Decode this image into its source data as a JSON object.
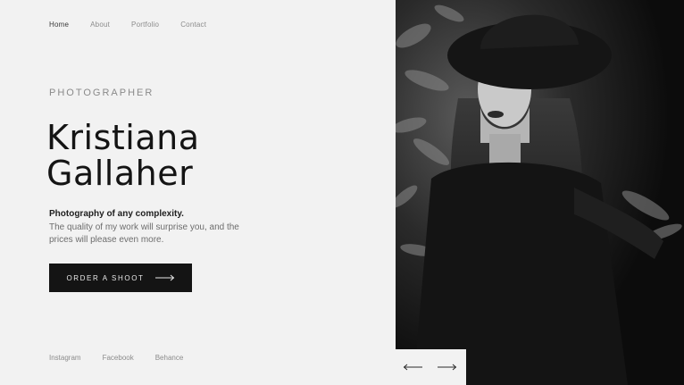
{
  "nav": {
    "items": [
      {
        "label": "Home",
        "active": true
      },
      {
        "label": "About",
        "active": false
      },
      {
        "label": "Portfolio",
        "active": false
      },
      {
        "label": "Contact",
        "active": false
      }
    ]
  },
  "hero": {
    "eyebrow": "PHOTOGRAPHER",
    "name_line1": "Kristiana",
    "name_line2": "Gallaher",
    "tagline": "Photography of any complexity.",
    "description": "The quality of my work will surprise you, and the prices will please even more.",
    "cta_label": "ORDER A SHOOT"
  },
  "social": {
    "items": [
      "Instagram",
      "Facebook",
      "Behance"
    ]
  },
  "pager": {
    "prev_icon": "arrow-left-icon",
    "next_icon": "arrow-right-icon"
  },
  "colors": {
    "background": "#f2f2f2",
    "dark": "#141414",
    "muted": "#8c8c8c"
  }
}
